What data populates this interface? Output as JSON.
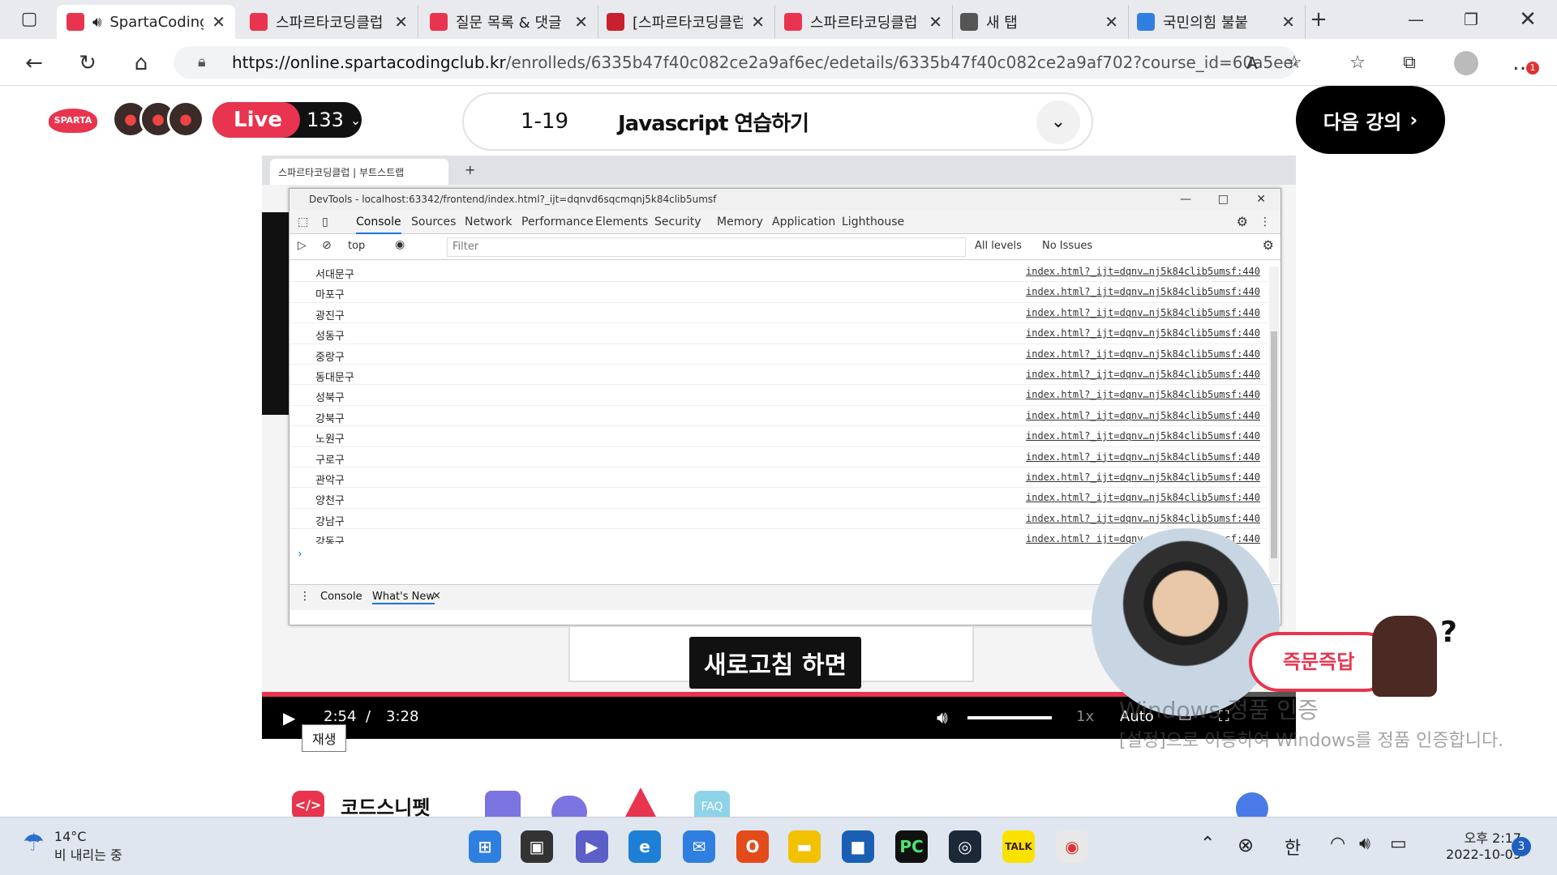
{
  "browser": {
    "tabs": [
      {
        "title": "SpartaCodingClub",
        "active": true,
        "favicon": "sparta-icon",
        "audio": true
      },
      {
        "title": "스파르타코딩클럽",
        "favicon": "sparta-heart-icon"
      },
      {
        "title": "질문 목록 & 댓글",
        "favicon": "sparta-heart-icon"
      },
      {
        "title": "[스파르타코딩클럽",
        "favicon": "red-book-icon"
      },
      {
        "title": "스파르타코딩클럽",
        "favicon": "sparta-heart-icon"
      },
      {
        "title": "새 탭",
        "favicon": "new-tab-icon"
      },
      {
        "title": "국민의힘 불붙",
        "favicon": "windows-icon"
      }
    ],
    "url_host": "https://online.spartacodingclub.kr",
    "url_path": "/enrolleds/6335b47f40c082ce2a9af6ec/edetails/6335b47f40c082ce2a9af702?course_id=60a5ee4...",
    "notification_badge": "1"
  },
  "header": {
    "logo_text": "SPARTA",
    "live_label": "Live",
    "live_count": "133",
    "lecture_number": "1-19",
    "lecture_title": "Javascript 연습하기",
    "next_button": "다음 강의"
  },
  "video": {
    "inner_tab_title": "스파르타코딩클럽 | 부트스트랩",
    "devtools": {
      "title": "DevTools - localhost:63342/frontend/index.html?_ijt=dqnvd6sqcmqnj5k84clib5umsf",
      "tabs": [
        "Console",
        "Sources",
        "Network",
        "Performance",
        "Elements",
        "Security",
        "Memory",
        "Application",
        "Lighthouse"
      ],
      "context": "top",
      "filter_placeholder": "Filter",
      "levels": "All levels",
      "issues": "No Issues",
      "source_link": "index.html?_ijt=dqnv…nj5k84clib5umsf:440",
      "rows": [
        "서대문구",
        "마포구",
        "광진구",
        "성동구",
        "중랑구",
        "동대문구",
        "성북구",
        "강북구",
        "노원구",
        "구로구",
        "관악구",
        "양천구",
        "강남구",
        "강동구"
      ],
      "drawer_tabs": [
        "Console",
        "What's New"
      ]
    },
    "subtitle": "새로고침 하면",
    "current_time": "2:54",
    "duration": "3:28",
    "progress_fraction": 0.837,
    "speed": "1x",
    "quality": "Auto",
    "play_tooltip": "재생",
    "ask_label": "즉문즉답"
  },
  "watermark": {
    "line1": "Windows 정품 인증",
    "line2": "[설정]으로 이동하여 Windows를 정품 인증합니다."
  },
  "bottom": {
    "snippet_label": "코드스니펫",
    "faq_label": "FAQ"
  },
  "taskbar": {
    "temperature": "14°C",
    "weather_text": "비 내리는 중",
    "ime": "한",
    "time": "오후 2:17",
    "date": "2022-10-09",
    "notifications": "3"
  },
  "colors": {
    "brand": "#e8344e",
    "link": "#1a73e8"
  }
}
